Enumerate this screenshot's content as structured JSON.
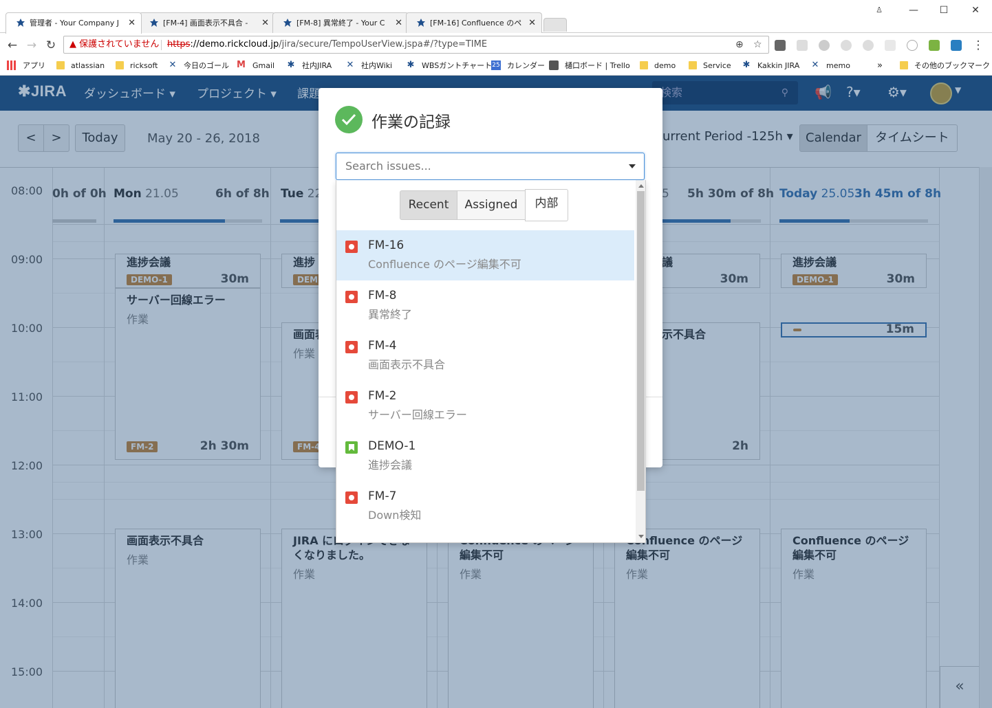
{
  "browser": {
    "tabs": [
      {
        "title": "管理者 - Your Company J"
      },
      {
        "title": "[FM-4] 画面表示不具合 -"
      },
      {
        "title": "[FM-8] 異常終了 - Your C"
      },
      {
        "title": "[FM-16] Confluence のペ"
      }
    ],
    "address": {
      "warning": "保護されていません",
      "scheme": "https",
      "host": "://demo.rickcloud.jp",
      "path": "/jira/secure/TempoUserView.jspa#/?type=TIME"
    },
    "bookmarks": [
      "アプリ",
      "atlassian",
      "ricksoft",
      "今日のゴール",
      "Gmail",
      "社内JIRA",
      "社内Wiki",
      "WBSガントチャート",
      "カレンダー",
      "樋口ボード | Trello",
      "demo",
      "Service",
      "Kakkin JIRA",
      "memo",
      "その他のブックマーク"
    ],
    "bookmarks_more": "»",
    "calendar_badge": "25"
  },
  "jira": {
    "logo": "JIRA",
    "nav": [
      "ダッシュボード ▾",
      "プロジェクト ▾",
      "課題"
    ],
    "search_placeholder": "検索"
  },
  "toolbar": {
    "prev": "<",
    "next": ">",
    "today": "Today",
    "date_range": "May 20 - 26, 2018",
    "period": "urrent Period -125h ▾",
    "view_calendar": "Calendar",
    "view_timesheet": "タイムシート"
  },
  "calendar": {
    "hours": [
      "08:00",
      "09:00",
      "10:00",
      "11:00",
      "12:00",
      "13:00",
      "14:00",
      "15:00"
    ],
    "days": [
      {
        "day": "",
        "date": "",
        "total": "0h of 0h",
        "progress": 1.0
      },
      {
        "day": "Mon",
        "date": "21.05",
        "total": "6h of 8h",
        "progress": 0.75
      },
      {
        "day": "Tue",
        "date": "22",
        "total": "",
        "progress": 1.0
      },
      {
        "day": "",
        "date": "",
        "total": "",
        "progress": 0
      },
      {
        "day": "",
        "date": "5",
        "total": "5h 30m of 8h",
        "progress": 0.69
      },
      {
        "day": "Today",
        "date": "25.05",
        "total": "3h 45m of 8h",
        "progress": 0.47
      }
    ],
    "worklogs": {
      "mon_meeting": {
        "title": "進捗会議",
        "key": "DEMO-1",
        "duration": "30m"
      },
      "mon_server": {
        "title": "サーバー回線エラー",
        "subtitle": "作業",
        "key": "FM-2",
        "duration": "2h 30m"
      },
      "mon_display": {
        "title": "画面表示不具合",
        "subtitle": "作業"
      },
      "tue_meeting": {
        "title": "進捗",
        "key": "DEM"
      },
      "tue_display": {
        "title": "画面表",
        "subtitle": "作業",
        "key": "FM-4"
      },
      "tue_jira": {
        "title": "JIRA にログインできなくなりました。",
        "subtitle": "作業"
      },
      "wed_conf": {
        "title": "Confluence のページ編集不可",
        "subtitle": "作業"
      },
      "thu_meeting": {
        "title": "議",
        "duration": "30m"
      },
      "thu_display": {
        "title": "示不具合",
        "duration": "2h"
      },
      "thu_conf": {
        "title": "Confluence のページ編集不可",
        "subtitle": "作業"
      },
      "fri_meeting": {
        "title": "進捗会議",
        "key": "DEMO-1",
        "duration": "30m"
      },
      "fri_short": {
        "duration": "15m"
      },
      "fri_conf": {
        "title": "Confluence のページ編集不可",
        "subtitle": "作業"
      }
    },
    "collapse": "«"
  },
  "dialog": {
    "title": "作業の記録",
    "search_placeholder": "Search issues...",
    "tabs": [
      "Recent",
      "Assigned",
      "内部"
    ],
    "issues": [
      {
        "key": "FM-16",
        "summary": "Confluence のページ編集不可",
        "type": "bug"
      },
      {
        "key": "FM-8",
        "summary": "異常終了",
        "type": "bug"
      },
      {
        "key": "FM-4",
        "summary": "画面表示不具合",
        "type": "bug"
      },
      {
        "key": "FM-2",
        "summary": "サーバー回線エラー",
        "type": "bug"
      },
      {
        "key": "DEMO-1",
        "summary": "進捗会議",
        "type": "story"
      },
      {
        "key": "FM-7",
        "summary": "Down検知",
        "type": "bug"
      }
    ]
  }
}
